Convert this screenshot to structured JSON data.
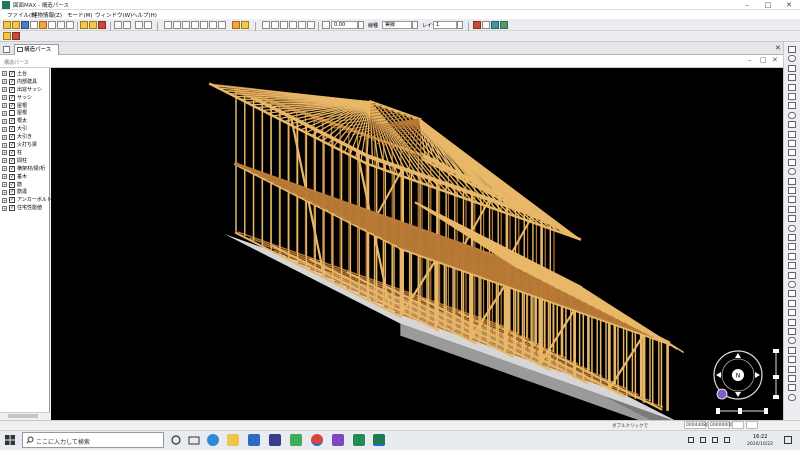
{
  "window": {
    "title": "図面MAX - 構造パース"
  },
  "menu": {
    "items": [
      "ファイル(F)",
      "建物情報(Z)",
      "モード(M)",
      "ウィンドウ(W)",
      "ヘルプ(H)"
    ]
  },
  "toolbar": {
    "value_field": "0.00",
    "line_type_label": "線種",
    "line_type_value": "実線",
    "layer_label": "レイヤ",
    "layer_value": "1"
  },
  "tab": {
    "label": "構造パース"
  },
  "child_window": {
    "title": "構造パース"
  },
  "tree": {
    "items": [
      {
        "label": "土台",
        "checked": true
      },
      {
        "label": "内部建具",
        "checked": true
      },
      {
        "label": "出窓サッシ",
        "checked": true
      },
      {
        "label": "サッシ",
        "checked": true
      },
      {
        "label": "屋根",
        "checked": true
      },
      {
        "label": "屋根",
        "checked": false
      },
      {
        "label": "根太",
        "checked": true
      },
      {
        "label": "大引",
        "checked": true
      },
      {
        "label": "大引き",
        "checked": true
      },
      {
        "label": "火打ち梁",
        "checked": true
      },
      {
        "label": "柱",
        "checked": true
      },
      {
        "label": "間柱",
        "checked": true
      },
      {
        "label": "横架材/梁/桁",
        "checked": true
      },
      {
        "label": "垂木",
        "checked": true
      },
      {
        "label": "筋",
        "checked": true
      },
      {
        "label": "筋違",
        "checked": true
      },
      {
        "label": "アンカーボルト",
        "checked": true
      },
      {
        "label": "住宅性能値",
        "checked": true
      }
    ]
  },
  "navigator": {
    "north_label": "N"
  },
  "status": {
    "mode_text": "ダブルクリックで",
    "coord_x": "00044080",
    "coord_y": "00000000"
  },
  "taskbar": {
    "search_placeholder": "ここに入力して検索",
    "time": "16:22",
    "date": "2020/10/22"
  },
  "colors": {
    "viewport_bg": "#000000",
    "lumber_light": "#e8b868",
    "lumber_dark": "#b87a35",
    "foundation": "#d6d6d6",
    "accent": "#1e7a52"
  }
}
